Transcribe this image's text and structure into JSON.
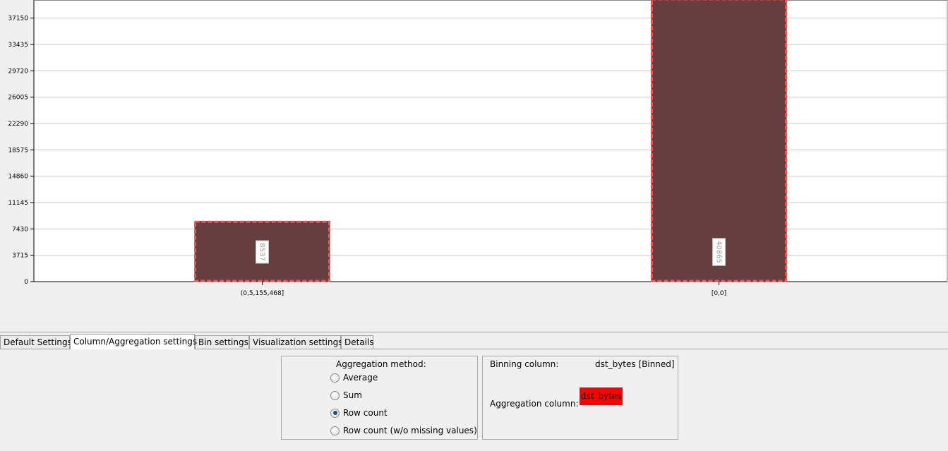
{
  "chart_data": {
    "type": "bar",
    "categories": [
      "(0,5,155,468]",
      "[0,0]"
    ],
    "values": [
      8537,
      40865
    ],
    "value_labels": [
      "8537",
      "40865"
    ],
    "yticks": [
      "0",
      "3715",
      "7430",
      "11145",
      "14860",
      "18575",
      "22290",
      "26005",
      "29720",
      "33435",
      "37150"
    ],
    "ylim": [
      0,
      39500
    ],
    "grid": true,
    "bar_fill": "#653f3f",
    "bar_outline": "#ff4d4d"
  },
  "tabs": [
    {
      "label": "Default Settings"
    },
    {
      "label": "Column/Aggregation settings"
    },
    {
      "label": "Bin settings"
    },
    {
      "label": "Visualization settings"
    },
    {
      "label": "Details"
    }
  ],
  "aggregation": {
    "title": "Aggregation method:",
    "options": [
      {
        "label": "Average",
        "selected": false
      },
      {
        "label": "Sum",
        "selected": false
      },
      {
        "label": "Row count",
        "selected": true
      },
      {
        "label": "Row count (w/o missing values)",
        "selected": false
      }
    ]
  },
  "binning": {
    "binning_label": "Binning column:",
    "binning_value": "dst_bytes [Binned]",
    "aggregation_label": "Aggregation column:",
    "aggregation_value": "dst_bytes",
    "aggregation_value_color": "#ff0000"
  }
}
